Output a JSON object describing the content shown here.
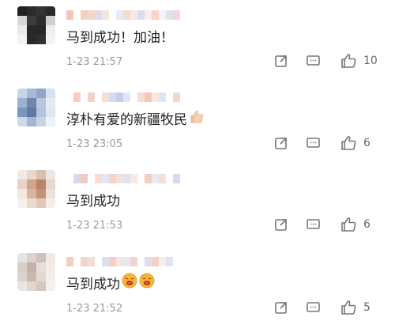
{
  "comments": [
    {
      "text": "马到成功！加油！",
      "time": "1-23 21:57",
      "likes": "10",
      "avatar_colors": [
        "#222",
        "#2b2b2b",
        "#333",
        "#2a2a2a",
        "#d7d7d7",
        "#3b3b3b",
        "#2d2d2d",
        "#cfcfcf",
        "#eaeaea",
        "#282828",
        "#272727",
        "#ededed",
        "#f4f4f4",
        "#292929",
        "#303030",
        "#f2f2f2"
      ],
      "name_colors": [
        "#f3c7b8",
        "#ffffff",
        "#f2d0c3",
        "#f6d6c9",
        "#dcdde6",
        "#f5e6da",
        "#ffffff",
        "#e8e9f1",
        "#f0ddd0",
        "#f8eadf",
        "#d9ddef",
        "#f7efe8",
        "#fbd3c7",
        "#f2f2f7",
        "#dde4ef",
        "#f6d7cf"
      ],
      "trailing_emoji": []
    },
    {
      "text": "淳朴有爱的新疆牧民",
      "time": "1-23 23:05",
      "likes": "6",
      "avatar_colors": [
        "#c7d4e8",
        "#a7b8d4",
        "#8fa6c8",
        "#d8e1ee",
        "#9db0cd",
        "#6f87ac",
        "#b9c6dc",
        "#e5eaf1",
        "#7c96bb",
        "#5e7aa3",
        "#b3c3dc",
        "#dfe6f0",
        "#d0d9e8",
        "#a3b7d2",
        "#c9d3e3",
        "#eef1f6"
      ],
      "name_colors": [
        "#ffffff",
        "#f6cdbf",
        "#ffffff",
        "#f1d3c7",
        "#ffffff",
        "#f4e0d6",
        "#d7dbf0",
        "#c8cfee",
        "#e3e6f4",
        "#ffffff",
        "#f3ddd5",
        "#f7c5b8",
        "#f8e8e3",
        "#dfe3f2",
        "#ffffff",
        "#f1d8cd"
      ],
      "trailing_emoji": [
        "thumbs-up"
      ]
    },
    {
      "text": "马到成功",
      "time": "1-23 21:53",
      "likes": "6",
      "avatar_colors": [
        "#f2e9e4",
        "#e9d6cc",
        "#d9bfae",
        "#efe6e1",
        "#e6d2c6",
        "#cfa58c",
        "#b98467",
        "#e8d9cf",
        "#f3e8e1",
        "#d8b39e",
        "#c49276",
        "#ede2da",
        "#f6efea",
        "#ead9ce",
        "#e2c8b8",
        "#f4ece7"
      ],
      "name_colors": [
        "#ffffff",
        "#d6d9ea",
        "#f4c9bb",
        "#ffffff",
        "#f7ddd3",
        "#e4e6f3",
        "#f4d3c7",
        "#f0e3dc",
        "#dfe2f2",
        "#f7e9e3",
        "#ffffff",
        "#f3cfc2",
        "#e8eaf3",
        "#f5e0d7",
        "#ffffff",
        "#d7dbef"
      ],
      "trailing_emoji": []
    },
    {
      "text": "马到成功",
      "time": "1-23 21:52",
      "likes": "5",
      "avatar_colors": [
        "#e9e4e1",
        "#dcd2cd",
        "#cfc1b9",
        "#efe9e6",
        "#d8cec8",
        "#c4b2a8",
        "#e6ddd8",
        "#f1ece9",
        "#ddd3ce",
        "#cbb8ae",
        "#e3d8d2",
        "#f2eeeb",
        "#ebe5e2",
        "#e0d6d0",
        "#d5c8c0",
        "#f4f0ed"
      ],
      "name_colors": [
        "#f6cdbf",
        "#ffffff",
        "#f3d4c8",
        "#f4ddd2",
        "#ffffff",
        "#dcdff0",
        "#f2d0c4",
        "#f7e4dc",
        "#e6e8f4",
        "#f3d5ca",
        "#ffffff",
        "#e5dbef",
        "#f1d1c6",
        "#f9ede7",
        "#dfe3f1",
        "#ffffff"
      ],
      "trailing_emoji": [
        "hot-face",
        "hot-face"
      ]
    }
  ]
}
